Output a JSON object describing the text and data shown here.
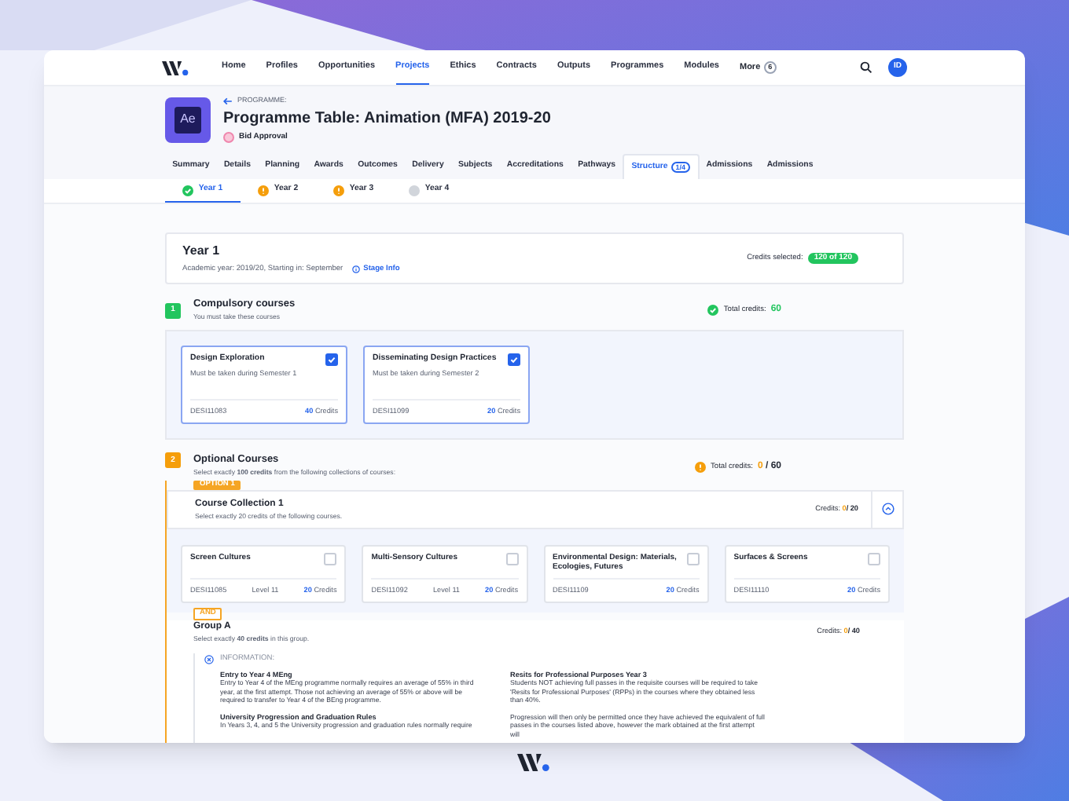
{
  "nav": {
    "items": [
      {
        "label": "Home",
        "selected": false
      },
      {
        "label": "Profiles",
        "selected": false
      },
      {
        "label": "Opportunities",
        "selected": false
      },
      {
        "label": "Projects",
        "selected": true
      },
      {
        "label": "Ethics",
        "selected": false
      },
      {
        "label": "Contracts",
        "selected": false
      },
      {
        "label": "Outputs",
        "selected": false
      },
      {
        "label": "Programmes",
        "selected": false
      },
      {
        "label": "Modules",
        "selected": false
      }
    ],
    "more": {
      "label": "More",
      "count": "6"
    },
    "avatar": "ID"
  },
  "header": {
    "app_icon": "Ae",
    "breadcrumb": "PROGRAMME:",
    "title": "Programme Table: Animation (MFA) 2019-20",
    "status": "Bid Approval"
  },
  "tabs": [
    {
      "label": "Summary",
      "selected": false
    },
    {
      "label": "Details",
      "selected": false
    },
    {
      "label": "Planning",
      "selected": false
    },
    {
      "label": "Awards",
      "selected": false
    },
    {
      "label": "Outcomes",
      "selected": false
    },
    {
      "label": "Delivery",
      "selected": false
    },
    {
      "label": "Subjects",
      "selected": false
    },
    {
      "label": "Accreditations",
      "selected": false
    },
    {
      "label": "Pathways",
      "selected": false
    },
    {
      "label": "Structure",
      "badge": "1/4",
      "selected": true
    },
    {
      "label": "Admissions",
      "selected": false
    },
    {
      "label": "Admissions",
      "selected": false
    }
  ],
  "year_tabs": [
    {
      "label": "Year 1",
      "kind": "complete",
      "selected": true
    },
    {
      "label": "Year 2",
      "kind": "warning",
      "selected": false
    },
    {
      "label": "Year 3",
      "kind": "warning",
      "selected": false
    },
    {
      "label": "Year 4",
      "kind": "pending",
      "selected": false
    }
  ],
  "stage": {
    "title": "Year 1",
    "subtitle": "Academic year: 2019/20, Starting in: September",
    "link": "Stage Info",
    "credits_label": "Credits selected:",
    "credits_value": "120 of 120"
  },
  "compulsory": {
    "number": "1",
    "kind": "complete",
    "title": "Compulsory courses",
    "subtitle": "You must take these courses",
    "total_label": "Total credits:",
    "total_value": "60",
    "courses": [
      {
        "name": "Design Exploration",
        "note": "Must be taken during Semester 1",
        "code": "DESI11083",
        "credits": "40",
        "credits_label": "Credits",
        "checked": true
      },
      {
        "name": "Disseminating Design Practices",
        "note": "Must be taken during Semester 2",
        "code": "DESI11099",
        "credits": "20",
        "credits_label": "Credits",
        "checked": true
      }
    ]
  },
  "optional": {
    "number": "2",
    "kind": "warning",
    "title": "Optional Courses",
    "subtitle": "Select exactly **100 credits** from the following collections of courses:",
    "total_label": "Total credits:",
    "total_selected": "0",
    "total_required": "/ 60",
    "option_tag": "OPTION 1",
    "collection": {
      "title": "Course Collection 1",
      "subtitle": "Select exactly 20 credits of the following courses.",
      "credits_label": "Credits:",
      "credits_selected": "0",
      "credits_required": "/ 20",
      "expanded": true,
      "courses": [
        {
          "name": "Screen Cultures",
          "code": "DESI11085",
          "level": "Level 11",
          "credits": "20",
          "credits_label": "Credits",
          "checked": false
        },
        {
          "name": "Multi-Sensory Cultures",
          "code": "DESI11092",
          "level": "Level 11",
          "credits": "20",
          "credits_label": "Credits",
          "checked": false
        },
        {
          "name": "Environmental Design: Materials, Ecologies, Futures",
          "code": "DESI11109",
          "credits": "20",
          "credits_label": "Credits",
          "checked": false
        },
        {
          "name": "Surfaces & Screens",
          "code": "DESI11110",
          "credits": "20",
          "credits_label": "Credits",
          "checked": false
        }
      ]
    },
    "and_tag": "AND",
    "group": {
      "title": "Group A",
      "subtitle": "Select exactly **40 credits** in this group.",
      "credits_label": "Credits:",
      "credits_selected": "0",
      "credits_required": "/ 40",
      "info": {
        "label": "INFORMATION:",
        "columns": [
          [
            {
              "heading": "Entry to Year 4 MEng",
              "text": "Entry to Year 4 of the MEng programme normally requires an average of 55% in third year, at the first attempt. Those not achieving an average of 55% or above will be required to transfer to Year 4 of the BEng programme."
            },
            {
              "heading": "University Progression and Graduation Rules",
              "text": "In Years 3, 4, and 5 the University progression and graduation rules normally require"
            }
          ],
          [
            {
              "heading": "Resits for Professional Purposes Year 3",
              "text": "Students NOT achieving full passes in the requisite courses will be required to take 'Resits for Professional Purposes' (RPPs) in the courses where they obtained less than 40%."
            },
            {
              "text": "Progression will then only be permitted once they have achieved the equivalent of full passes in the courses listed above, however the mark obtained at the first attempt will"
            }
          ]
        ]
      }
    }
  }
}
